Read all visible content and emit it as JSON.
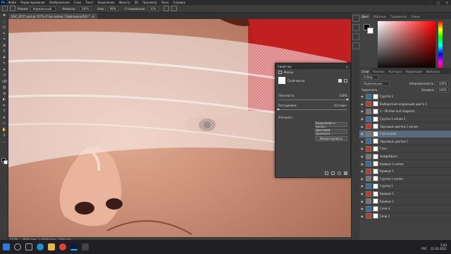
{
  "app": {
    "logo": "Ps"
  },
  "menu": [
    "Файл",
    "Редактирование",
    "Изображение",
    "Слои",
    "Текст",
    "Выделение",
    "Фильтр",
    "3D",
    "Просмотр",
    "Окно",
    "Справка"
  ],
  "window_controls": [
    "–",
    "□",
    "✕"
  ],
  "options": {
    "mode_label": "Режим:",
    "mode_value": "Нормальный",
    "opacity_label": "Непрозр.:",
    "opacity_value": "100%",
    "flow_label": "Наж.:",
    "flow_value": "80%",
    "smooth_label": "Сглаживание:",
    "smooth_value": "10%"
  },
  "document_tab": {
    "title": "DSC_8727.psd @ 227% (Глаз копия, Слой-маска/16) *",
    "close": "✕"
  },
  "toolbar_icons": [
    "move-icon",
    "marquee-icon",
    "lasso-icon",
    "quick-select-icon",
    "crop-icon",
    "frame-icon",
    "eyedropper-icon",
    "healing-icon",
    "brush-icon",
    "stamp-icon",
    "history-brush-icon",
    "eraser-icon",
    "gradient-icon",
    "blur-icon",
    "dodge-icon",
    "pen-icon",
    "type-icon",
    "path-select-icon",
    "shape-icon",
    "hand-icon",
    "zoom-icon",
    "more-icon"
  ],
  "colors": {
    "foreground": "#000000",
    "background": "#ffffff",
    "accent": "#31a8ff",
    "selected_layer": "#5a6b7e",
    "picker_hue": "#ff0000"
  },
  "status": {
    "zoom": "227%",
    "doc": "3840 пикс. x 4448 пикс. (300 ppi)"
  },
  "color_panel": {
    "tabs": [
      "Цвет",
      "Образцы",
      "Градиенты",
      "Узоры"
    ]
  },
  "layers_panel": {
    "tabs": [
      "Слои",
      "Каналы",
      "Контуры",
      "Коррекция",
      "Фильтры"
    ],
    "search_label": "Q Вид",
    "blend_value": "Нормальные",
    "opacity_label": "Непрозрачность:",
    "opacity_value": "100%",
    "lock_label": "Закрепить:",
    "fill_label": "Заливка:",
    "fill_value": "100%",
    "layers": [
      {
        "name": "Группа 3",
        "sel": false
      },
      {
        "name": "Выборочная коррекция цвета 1",
        "sel": false
      },
      {
        "name": "3 - lift blue and magenta",
        "sel": false
      },
      {
        "name": "Группа 1 копия 1",
        "sel": false
      },
      {
        "name": "Звуковые цветки 1 копия",
        "sel": false
      },
      {
        "name": "Глаз копия",
        "sel": true
      },
      {
        "name": "Звуковые цветки 1",
        "sel": false
      },
      {
        "name": "Глаз",
        "sel": false
      },
      {
        "name": "dodge&burn",
        "sel": false
      },
      {
        "name": "Кривые 1 копия",
        "sel": false
      },
      {
        "name": "Кривые 1",
        "sel": false
      },
      {
        "name": "Группа 1 копия",
        "sel": false
      },
      {
        "name": "Группа 1",
        "sel": false
      },
      {
        "name": "Кривые 1",
        "sel": false
      },
      {
        "name": "Кривые 1",
        "sel": false
      },
      {
        "name": "Слой 4",
        "sel": false
      },
      {
        "name": "Слой 2",
        "sel": false
      }
    ]
  },
  "properties": {
    "title": "Свойства",
    "tab": "Маски",
    "mask_label": "Слой-маска",
    "density_label": "Плотность:",
    "density_value": "100%",
    "feather_label": "Растушевка:",
    "feather_value": "0,0 пикс.",
    "refine_label": "Уточнить:",
    "btn_select_mask": "Выделение и маска...",
    "btn_color_range": "Цветовой диапазон...",
    "btn_invert": "Инвертировать"
  },
  "taskbar": {
    "time": "5:04",
    "date": "22.03.2021",
    "lang": "РУС"
  }
}
